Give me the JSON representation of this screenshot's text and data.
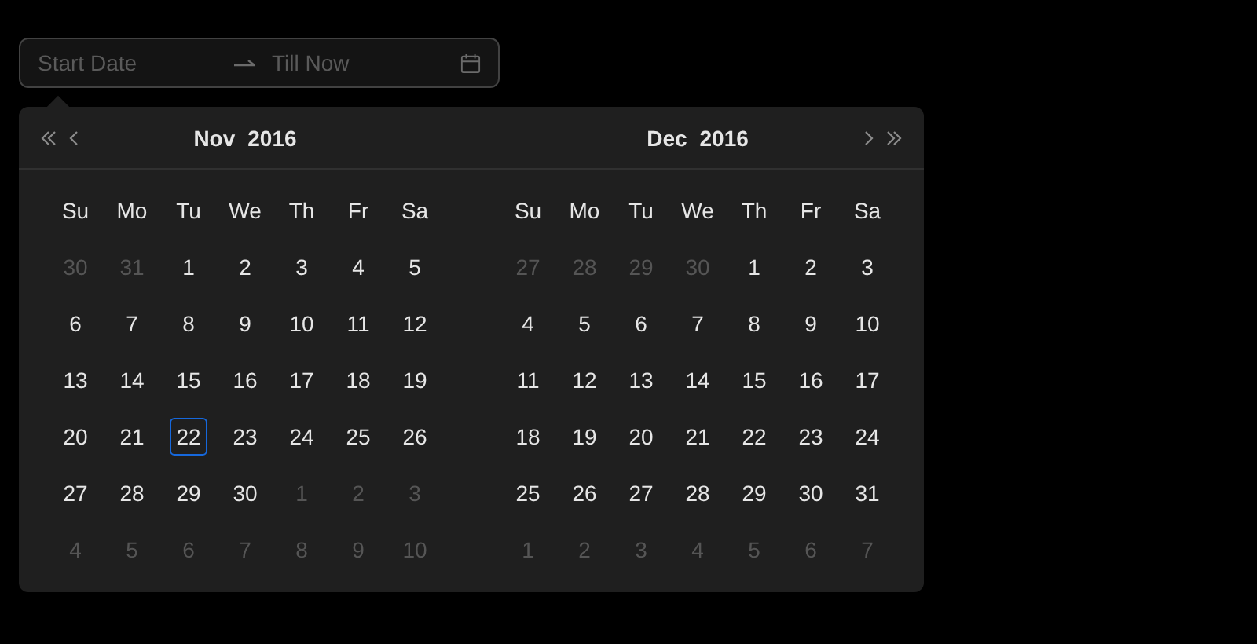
{
  "range_input": {
    "start_placeholder": "Start Date",
    "end_placeholder": "Till Now"
  },
  "months": [
    {
      "month": "Nov",
      "year": "2016",
      "weekdays": [
        "Su",
        "Mo",
        "Tu",
        "We",
        "Th",
        "Fr",
        "Sa"
      ],
      "weeks": [
        [
          {
            "day": "30",
            "outside": true,
            "today": false
          },
          {
            "day": "31",
            "outside": true,
            "today": false
          },
          {
            "day": "1",
            "outside": false,
            "today": false
          },
          {
            "day": "2",
            "outside": false,
            "today": false
          },
          {
            "day": "3",
            "outside": false,
            "today": false
          },
          {
            "day": "4",
            "outside": false,
            "today": false
          },
          {
            "day": "5",
            "outside": false,
            "today": false
          }
        ],
        [
          {
            "day": "6",
            "outside": false,
            "today": false
          },
          {
            "day": "7",
            "outside": false,
            "today": false
          },
          {
            "day": "8",
            "outside": false,
            "today": false
          },
          {
            "day": "9",
            "outside": false,
            "today": false
          },
          {
            "day": "10",
            "outside": false,
            "today": false
          },
          {
            "day": "11",
            "outside": false,
            "today": false
          },
          {
            "day": "12",
            "outside": false,
            "today": false
          }
        ],
        [
          {
            "day": "13",
            "outside": false,
            "today": false
          },
          {
            "day": "14",
            "outside": false,
            "today": false
          },
          {
            "day": "15",
            "outside": false,
            "today": false
          },
          {
            "day": "16",
            "outside": false,
            "today": false
          },
          {
            "day": "17",
            "outside": false,
            "today": false
          },
          {
            "day": "18",
            "outside": false,
            "today": false
          },
          {
            "day": "19",
            "outside": false,
            "today": false
          }
        ],
        [
          {
            "day": "20",
            "outside": false,
            "today": false
          },
          {
            "day": "21",
            "outside": false,
            "today": false
          },
          {
            "day": "22",
            "outside": false,
            "today": true
          },
          {
            "day": "23",
            "outside": false,
            "today": false
          },
          {
            "day": "24",
            "outside": false,
            "today": false
          },
          {
            "day": "25",
            "outside": false,
            "today": false
          },
          {
            "day": "26",
            "outside": false,
            "today": false
          }
        ],
        [
          {
            "day": "27",
            "outside": false,
            "today": false
          },
          {
            "day": "28",
            "outside": false,
            "today": false
          },
          {
            "day": "29",
            "outside": false,
            "today": false
          },
          {
            "day": "30",
            "outside": false,
            "today": false
          },
          {
            "day": "1",
            "outside": true,
            "today": false
          },
          {
            "day": "2",
            "outside": true,
            "today": false
          },
          {
            "day": "3",
            "outside": true,
            "today": false
          }
        ],
        [
          {
            "day": "4",
            "outside": true,
            "today": false
          },
          {
            "day": "5",
            "outside": true,
            "today": false
          },
          {
            "day": "6",
            "outside": true,
            "today": false
          },
          {
            "day": "7",
            "outside": true,
            "today": false
          },
          {
            "day": "8",
            "outside": true,
            "today": false
          },
          {
            "day": "9",
            "outside": true,
            "today": false
          },
          {
            "day": "10",
            "outside": true,
            "today": false
          }
        ]
      ]
    },
    {
      "month": "Dec",
      "year": "2016",
      "weekdays": [
        "Su",
        "Mo",
        "Tu",
        "We",
        "Th",
        "Fr",
        "Sa"
      ],
      "weeks": [
        [
          {
            "day": "27",
            "outside": true,
            "today": false
          },
          {
            "day": "28",
            "outside": true,
            "today": false
          },
          {
            "day": "29",
            "outside": true,
            "today": false
          },
          {
            "day": "30",
            "outside": true,
            "today": false
          },
          {
            "day": "1",
            "outside": false,
            "today": false
          },
          {
            "day": "2",
            "outside": false,
            "today": false
          },
          {
            "day": "3",
            "outside": false,
            "today": false
          }
        ],
        [
          {
            "day": "4",
            "outside": false,
            "today": false
          },
          {
            "day": "5",
            "outside": false,
            "today": false
          },
          {
            "day": "6",
            "outside": false,
            "today": false
          },
          {
            "day": "7",
            "outside": false,
            "today": false
          },
          {
            "day": "8",
            "outside": false,
            "today": false
          },
          {
            "day": "9",
            "outside": false,
            "today": false
          },
          {
            "day": "10",
            "outside": false,
            "today": false
          }
        ],
        [
          {
            "day": "11",
            "outside": false,
            "today": false
          },
          {
            "day": "12",
            "outside": false,
            "today": false
          },
          {
            "day": "13",
            "outside": false,
            "today": false
          },
          {
            "day": "14",
            "outside": false,
            "today": false
          },
          {
            "day": "15",
            "outside": false,
            "today": false
          },
          {
            "day": "16",
            "outside": false,
            "today": false
          },
          {
            "day": "17",
            "outside": false,
            "today": false
          }
        ],
        [
          {
            "day": "18",
            "outside": false,
            "today": false
          },
          {
            "day": "19",
            "outside": false,
            "today": false
          },
          {
            "day": "20",
            "outside": false,
            "today": false
          },
          {
            "day": "21",
            "outside": false,
            "today": false
          },
          {
            "day": "22",
            "outside": false,
            "today": false
          },
          {
            "day": "23",
            "outside": false,
            "today": false
          },
          {
            "day": "24",
            "outside": false,
            "today": false
          }
        ],
        [
          {
            "day": "25",
            "outside": false,
            "today": false
          },
          {
            "day": "26",
            "outside": false,
            "today": false
          },
          {
            "day": "27",
            "outside": false,
            "today": false
          },
          {
            "day": "28",
            "outside": false,
            "today": false
          },
          {
            "day": "29",
            "outside": false,
            "today": false
          },
          {
            "day": "30",
            "outside": false,
            "today": false
          },
          {
            "day": "31",
            "outside": false,
            "today": false
          }
        ],
        [
          {
            "day": "1",
            "outside": true,
            "today": false
          },
          {
            "day": "2",
            "outside": true,
            "today": false
          },
          {
            "day": "3",
            "outside": true,
            "today": false
          },
          {
            "day": "4",
            "outside": true,
            "today": false
          },
          {
            "day": "5",
            "outside": true,
            "today": false
          },
          {
            "day": "6",
            "outside": true,
            "today": false
          },
          {
            "day": "7",
            "outside": true,
            "today": false
          }
        ]
      ]
    }
  ]
}
